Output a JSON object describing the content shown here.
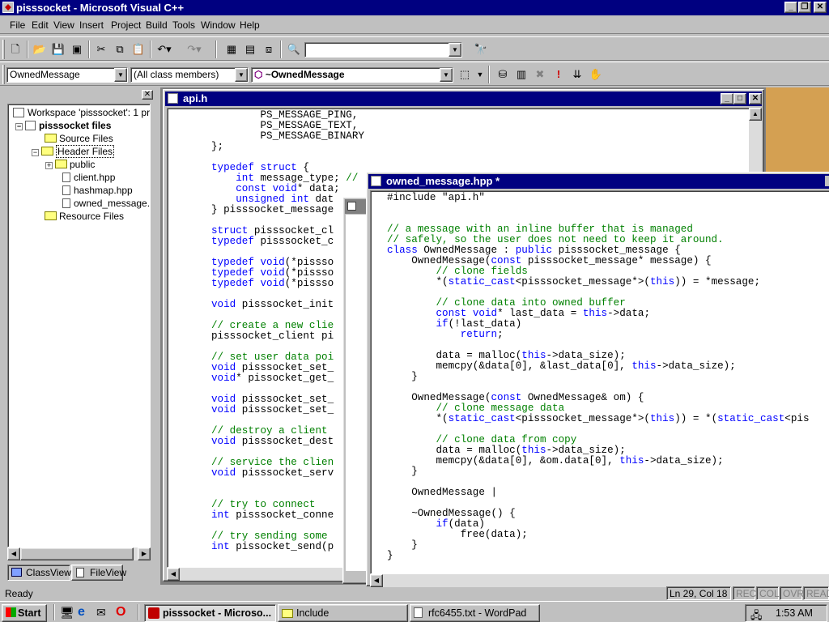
{
  "window": {
    "title": "pisssocket - Microsoft Visual C++"
  },
  "menu": [
    "File",
    "Edit",
    "View",
    "Insert",
    "Project",
    "Build",
    "Tools",
    "Window",
    "Help"
  ],
  "toolbar": {
    "find_value": ""
  },
  "wizardbar": {
    "class_combo": "OwnedMessage",
    "filter_combo": "(All class members)",
    "member_combo": "~OwnedMessage"
  },
  "workspace": {
    "root": "Workspace 'pisssocket': 1 proje",
    "project": "pisssocket files",
    "source": "Source Files",
    "header": "Header Files",
    "public": "public",
    "files": [
      "client.hpp",
      "hashmap.hpp",
      "owned_message.h"
    ],
    "resource": "Resource Files",
    "tab_class": "ClassView",
    "tab_file": "FileView"
  },
  "api_window": {
    "title": "api.h",
    "lines": [
      "        PS_MESSAGE_PING,",
      "        PS_MESSAGE_TEXT,",
      "        PS_MESSAGE_BINARY",
      "};",
      "",
      "typedef struct {",
      "    int message_type; //",
      "    const void* data;",
      "    unsigned int dat",
      "} pisssocket_message",
      "",
      "struct pisssocket_cl",
      "typedef pisssocket_c",
      "",
      "typedef void(*pissso",
      "typedef void(*pissso",
      "typedef void(*pissso",
      "",
      "void pisssocket_init",
      "",
      "// create a new clie",
      "pisssocket_client pi",
      "",
      "// set user data poi",
      "void pisssocket_set_",
      "void* pissocket_get_",
      "",
      "void pisssocket_set_",
      "void pisssocket_set_",
      "",
      "// destroy a client",
      "void pisssocket_dest",
      "",
      "// service the clien",
      "void pisssocket_serv",
      "",
      "",
      "// try to connect",
      "int pisssocket_conne",
      "",
      "// try sending some",
      "int pissocket_send(p"
    ]
  },
  "owned_window": {
    "title": "owned_message.hpp *",
    "lines": [
      "#include \"api.h\"",
      "",
      "",
      "// a message with an inline buffer that is managed",
      "// safely, so the user does not need to keep it around.",
      "class OwnedMessage : public pisssocket_message {",
      "    OwnedMessage(const pisssocket_message* message) {",
      "        // clone fields",
      "        *(static_cast<pisssocket_message*>(this)) = *message;",
      "",
      "        // clone data into owned buffer",
      "        const void* last_data = this->data;",
      "        if(!last_data)",
      "            return;",
      "",
      "        data = malloc(this->data_size);",
      "        memcpy(&data[0], &last_data[0], this->data_size);",
      "    }",
      "",
      "    OwnedMessage(const OwnedMessage& om) {",
      "        // clone message data",
      "        *(static_cast<pisssocket_message*>(this)) = *(static_cast<pis",
      "",
      "        // clone data from copy",
      "        data = malloc(this->data_size);",
      "        memcpy(&data[0], &om.data[0], this->data_size);",
      "    }",
      "",
      "    OwnedMessage |",
      "",
      "    ~OwnedMessage() {",
      "        if(data)",
      "            free(data);",
      "    }",
      "}"
    ]
  },
  "status": {
    "text": "Ready",
    "position": "Ln 29, Col 18",
    "rec": "REC",
    "col": "COL",
    "ovr": "OVR",
    "read": "READ"
  },
  "taskbar": {
    "start": "Start",
    "tasks": [
      "pisssocket - Microso...",
      "Include",
      "rfc6455.txt - WordPad"
    ],
    "clock": "1:53 AM"
  }
}
